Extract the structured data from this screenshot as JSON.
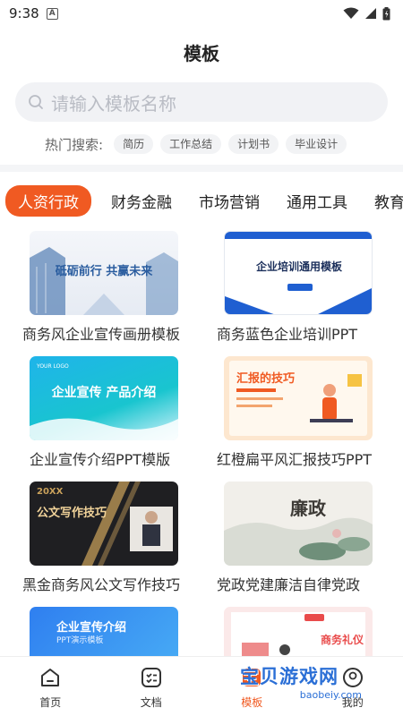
{
  "status": {
    "time": "9:38",
    "notif_letter": "A"
  },
  "header": {
    "title": "模板"
  },
  "search": {
    "placeholder": "请输入模板名称"
  },
  "hot": {
    "label": "热门搜索:",
    "chips": [
      "简历",
      "工作总结",
      "计划书",
      "毕业设计"
    ]
  },
  "categories": [
    "人资行政",
    "财务金融",
    "市场营销",
    "通用工具",
    "教育"
  ],
  "templates": [
    {
      "caption": "商务风企业宣传画册模板",
      "thumb_text": "砥砺前行 共赢未来"
    },
    {
      "caption": "商务蓝色企业培训PPT",
      "thumb_text": "企业培训通用模板"
    },
    {
      "caption": "企业宣传介绍PPT模版",
      "thumb_text": "企业宣传 产品介绍",
      "thumb_sub": "YOUR LOGO"
    },
    {
      "caption": "红橙扁平风汇报技巧PPT",
      "thumb_text": "汇报的技巧"
    },
    {
      "caption": "黑金商务风公文写作技巧",
      "thumb_text": "公文写作技巧",
      "thumb_sub": "20XX"
    },
    {
      "caption": "党政党建廉洁自律党政",
      "thumb_text": "廉政"
    },
    {
      "caption": "",
      "thumb_text": "企业宣传介绍",
      "thumb_sub": "PPT演示模板"
    },
    {
      "caption": "",
      "thumb_text": "商务礼仪"
    }
  ],
  "nav": [
    {
      "label": "首页"
    },
    {
      "label": "文档"
    },
    {
      "label": "模板"
    },
    {
      "label": "我的"
    }
  ],
  "watermark": {
    "text": "宝贝游戏网",
    "url": "baobeiy.com"
  },
  "colors": {
    "accent": "#f05a22",
    "watermark": "#2b6fd6"
  }
}
